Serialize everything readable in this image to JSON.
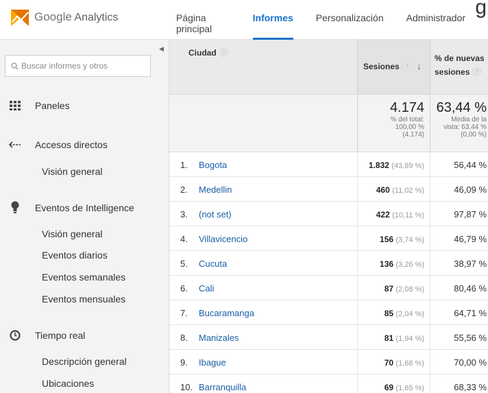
{
  "header": {
    "brand": "Google",
    "product": "Analytics",
    "nav": [
      "Página principal",
      "Informes",
      "Personalización",
      "Administrador"
    ],
    "active_nav": "Informes",
    "edge_letter": "g"
  },
  "sidebar": {
    "search_placeholder": "Buscar informes y otros",
    "sections": {
      "paneles": "Paneles",
      "accesos": "Accesos directos",
      "accesos_sub": "Visión general",
      "eventos": "Eventos de Intelligence",
      "eventos_subs": [
        "Visión general",
        "Eventos diarios",
        "Eventos semanales",
        "Eventos mensuales"
      ],
      "tiempo": "Tiempo real",
      "tiempo_subs": [
        "Descripción general",
        "Ubicaciones"
      ]
    }
  },
  "table": {
    "col_city": "Ciudad",
    "col_sessions": "Sesiones",
    "col_new_1": "% de nuevas",
    "col_new_2": "sesiones",
    "totals": {
      "sessions": "4.174",
      "sessions_sub1": "% del total:",
      "sessions_sub2": "100,00 %",
      "sessions_sub3": "(4.174)",
      "new": "63,44 %",
      "new_sub1": "Media de la",
      "new_sub2": "vista: 63,44 %",
      "new_sub3": "(0,00 %)"
    },
    "rows": [
      {
        "n": "1.",
        "city": "Bogota",
        "sessions": "1.832",
        "pct": "(43,89 %)",
        "new": "56,44 %"
      },
      {
        "n": "2.",
        "city": "Medellin",
        "sessions": "460",
        "pct": "(11,02 %)",
        "new": "46,09 %"
      },
      {
        "n": "3.",
        "city": "(not set)",
        "sessions": "422",
        "pct": "(10,11 %)",
        "new": "97,87 %"
      },
      {
        "n": "4.",
        "city": "Villavicencio",
        "sessions": "156",
        "pct": "(3,74 %)",
        "new": "46,79 %"
      },
      {
        "n": "5.",
        "city": "Cucuta",
        "sessions": "136",
        "pct": "(3,26 %)",
        "new": "38,97 %"
      },
      {
        "n": "6.",
        "city": "Cali",
        "sessions": "87",
        "pct": "(2,08 %)",
        "new": "80,46 %"
      },
      {
        "n": "7.",
        "city": "Bucaramanga",
        "sessions": "85",
        "pct": "(2,04 %)",
        "new": "64,71 %"
      },
      {
        "n": "8.",
        "city": "Manizales",
        "sessions": "81",
        "pct": "(1,94 %)",
        "new": "55,56 %"
      },
      {
        "n": "9.",
        "city": "Ibague",
        "sessions": "70",
        "pct": "(1,68 %)",
        "new": "70,00 %"
      },
      {
        "n": "10.",
        "city": "Barranquilla",
        "sessions": "69",
        "pct": "(1,65 %)",
        "new": "68,33 %"
      }
    ]
  }
}
